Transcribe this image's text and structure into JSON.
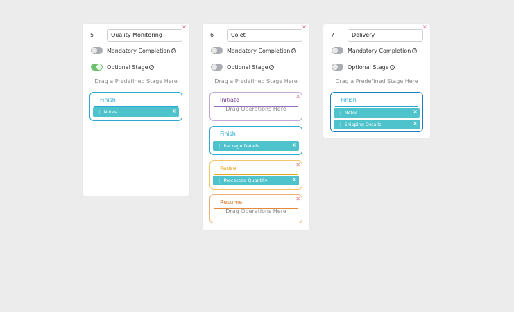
{
  "cards": [
    {
      "number": "5",
      "name": "Quality Monitoring",
      "mandatory_label": "Mandatory Completion",
      "mandatory_on": false,
      "optional_label": "Optional Stage",
      "optional_on": true,
      "drop_hint": "Drag a Predefined Stage Here",
      "stages": [
        {
          "title": "Finish",
          "type": "finish",
          "operations": [
            "Notes"
          ]
        }
      ]
    },
    {
      "number": "6",
      "name": "Colet",
      "mandatory_label": "Mandatory Completion",
      "mandatory_on": false,
      "optional_label": "Optional Stage",
      "optional_on": false,
      "drop_hint": "Drag a Predefined Stage Here",
      "stages": [
        {
          "title": "Initiate",
          "type": "initiate",
          "operations": [],
          "empty_hint": "Drag Operations Here"
        },
        {
          "title": "Finish",
          "type": "finish",
          "operations": [
            "Package Details"
          ]
        },
        {
          "title": "Pause",
          "type": "pause",
          "operations": [
            "Processed Quantity"
          ]
        },
        {
          "title": "Resume",
          "type": "resume",
          "operations": [],
          "empty_hint": "Drag Operations Here"
        }
      ]
    },
    {
      "number": "7",
      "name": "Delivery",
      "mandatory_label": "Mandatory Completion",
      "mandatory_on": false,
      "optional_label": "Optional Stage",
      "optional_on": false,
      "drop_hint": "Drag a Predefined Stage Here",
      "stages": [
        {
          "title": "Finish",
          "type": "finish",
          "operations": [
            "Notes",
            "Shipping Details"
          ]
        }
      ]
    }
  ],
  "icons": {
    "close": "close-icon",
    "help": "help-icon",
    "drag": "drag-handle-icon"
  },
  "colors": {
    "finish": "#2aa7d4",
    "initiate": "#6d3a8f",
    "pause": "#e6a923",
    "resume": "#d67a2b",
    "operation": "#4fc3cc",
    "toggle_on": "#6dc06d",
    "close": "#e07a8a"
  }
}
